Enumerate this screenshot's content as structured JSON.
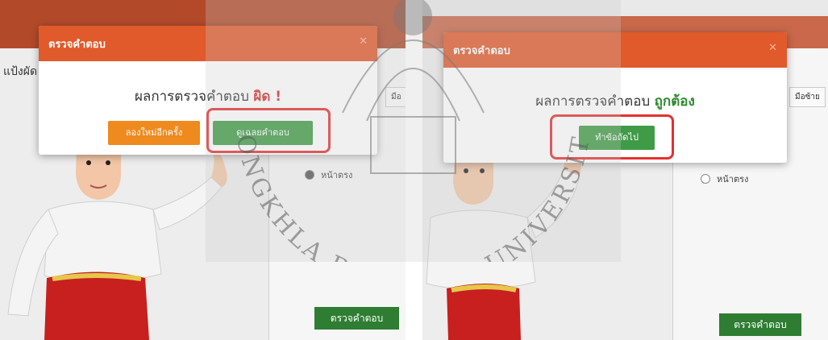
{
  "left": {
    "modal_title": "ตรวจคำตอบ",
    "result_prefix": "ผลการตรวจคำตอบ",
    "result_value": "ผิด !",
    "retry_button": "ลองใหม่อีกครั้ง",
    "show_answer_button": "ดูเฉลยคำตอบ",
    "partial_label": "แป้งผัด",
    "partial_tab": "มือ",
    "option_label": "หน้าตรง",
    "check_button": "ตรวจคำตอบ"
  },
  "right": {
    "modal_title": "ตรวจคำตอบ",
    "result_prefix": "ผลการตรวจคำตอบ",
    "result_value": "ถูกต้อง",
    "next_button": "ทำข้อถัดไป",
    "tab_label": "มือซ้าย",
    "option_label": "หน้าตรง",
    "check_button": "ตรวจคำตอบ"
  },
  "watermark": {
    "text": "SONGKHLA RAJABHAT UNIVERSITY"
  },
  "colors": {
    "modal_header": "#e05a2b",
    "wrong": "#d32f2f",
    "correct": "#2e8b2e",
    "retry": "#ef8a1f",
    "green_button": "#3f9b46",
    "highlight": "#e53030"
  }
}
